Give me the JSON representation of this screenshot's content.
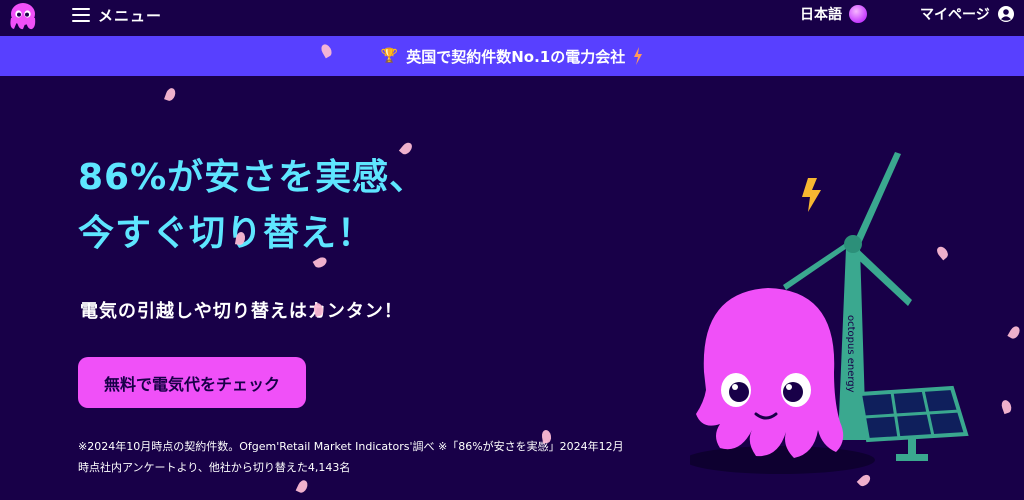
{
  "header": {
    "logo_icon": "octopus-logo-icon",
    "menu_label": "メニュー",
    "language_label": "日本語",
    "mypage_label": "マイページ"
  },
  "banner": {
    "text": "英国で契約件数No.1の電力会社",
    "left_icon": "trophy-icon",
    "right_icon": "lightning-icon"
  },
  "hero": {
    "headline_line1": "86%が安さを実感、",
    "headline_line2": "今すぐ切り替え！",
    "subline": "電気の引越しや切り替えはカンタン！",
    "cta_label": "無料で電気代をチェック",
    "footnote_line1": "※2024年10月時点の契約件数。Ofgem'Retail Market Indicators'調べ ※「86%が安さを実感」2024年12月",
    "footnote_line2": "時点社内アンケートより、他社から切り替えた4,143名",
    "turbine_text": "octopus energy"
  },
  "colors": {
    "background": "#180048",
    "banner": "#5840ff",
    "headline": "#5ee6ff",
    "cta": "#f050f8",
    "mascot": "#f050f8",
    "turbine": "#3aa88f"
  }
}
